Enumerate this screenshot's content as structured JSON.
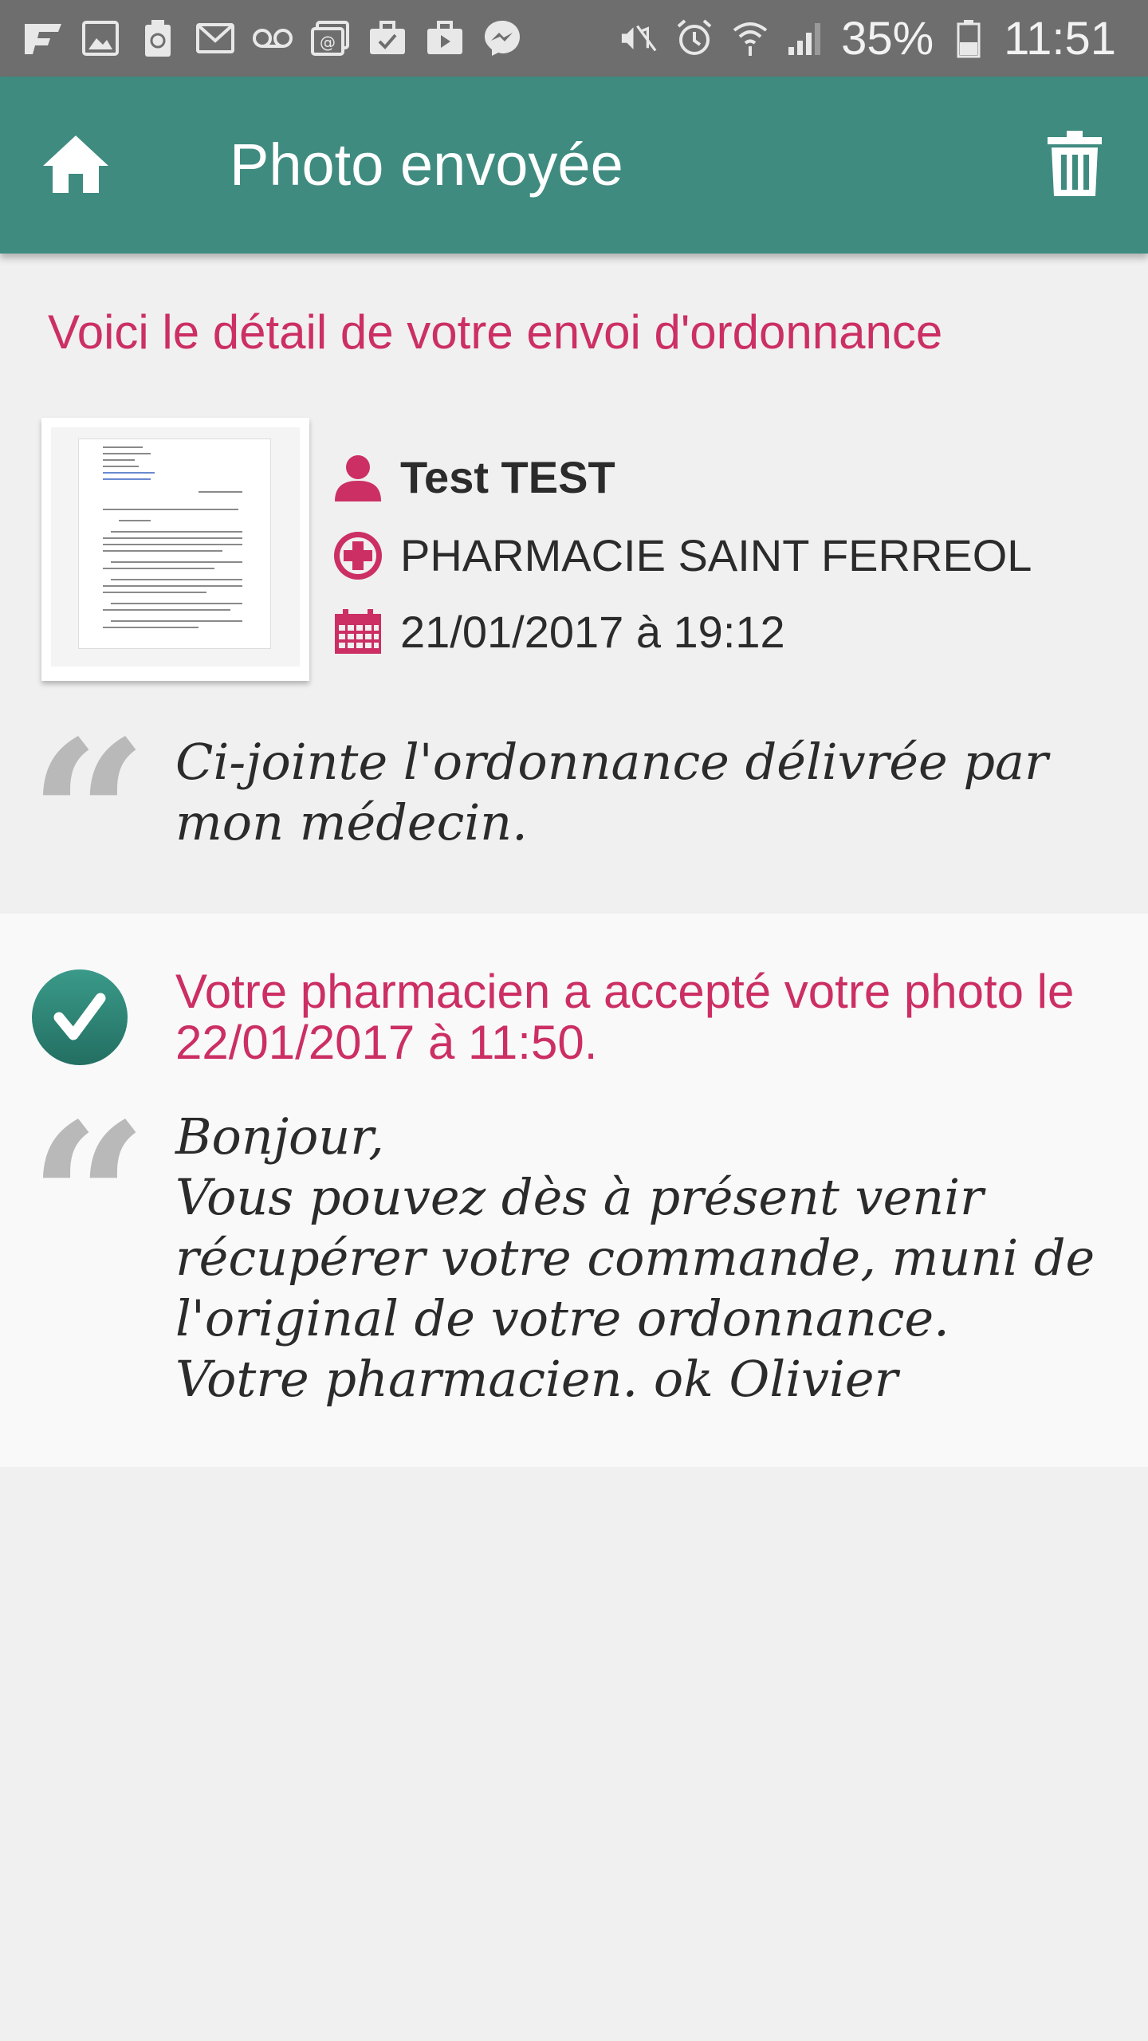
{
  "status_bar": {
    "notification_icons": [
      "flipboard-icon",
      "image-icon",
      "recycle-icon",
      "gmail-icon",
      "voicemail-icon",
      "email-icon",
      "briefcase-check-icon",
      "briefcase-play-icon",
      "messenger-icon"
    ],
    "system_icons": [
      "mute-icon",
      "alarm-icon",
      "wifi-icon",
      "signal-icon"
    ],
    "battery": "35%",
    "time": "11:51"
  },
  "app_bar": {
    "title": "Photo envoyée",
    "color": "#3f8b80"
  },
  "detail": {
    "intro": "Voici le détail de votre envoi d'ordonnance",
    "patient_name": "Test TEST",
    "pharmacy": "PHARMACIE SAINT FERREOL",
    "date_sent": "21/01/2017 à 19:12",
    "message": "Ci-jointe l'ordonnance délivrée par mon médecin."
  },
  "response": {
    "status": "Votre pharmacien a accepté votre photo le 22/01/2017 à 11:50.",
    "message": "Bonjour,\nVous pouvez dès à présent venir récupérer votre commande, muni de l'original de votre ordonnance.\nVotre pharmacien. ok Olivier"
  },
  "colors": {
    "accent": "#cc2f63",
    "check": "#2f8576"
  }
}
